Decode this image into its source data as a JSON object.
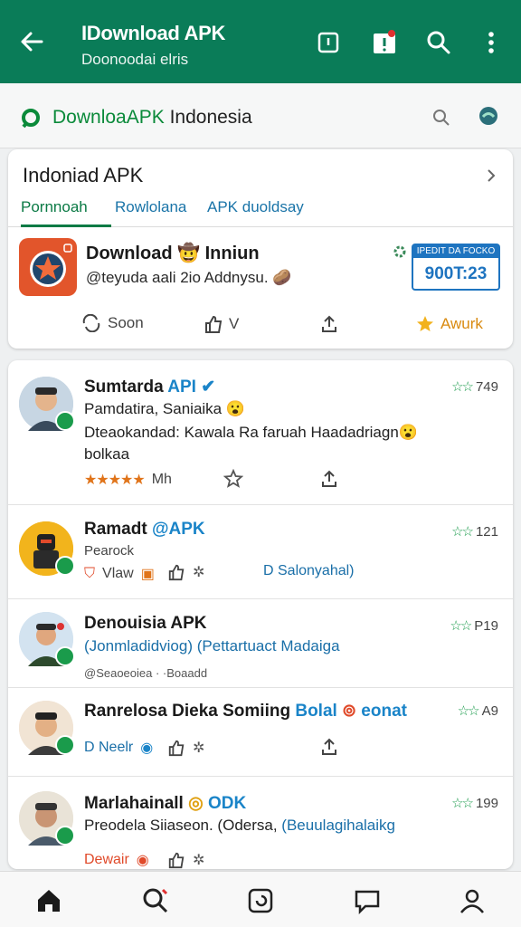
{
  "appbar": {
    "title": "IDownload APK",
    "subtitle": "Doonoodai elris",
    "icons": [
      "back-arrow-icon",
      "phone-icon",
      "alert-icon",
      "search-icon",
      "more-vert-icon"
    ]
  },
  "search": {
    "text_green": "DownloaAPK",
    "text_rest": " Indonesia"
  },
  "featured_card": {
    "title": "Indoniad APK",
    "tabs": [
      "Pornnoah",
      "Rowlolana",
      "APK duoldsay"
    ],
    "app_name": "Download",
    "app_name_suffix": "Inniun",
    "app_sub": "@teyuda aali 2io Addnysu.",
    "badge_top": "IPEDIT DA FOCKO",
    "badge_value": "900T:23",
    "actions": {
      "share": "Soon",
      "like": "V",
      "award": "Awurk"
    },
    "colors": {
      "award": "#e09a12",
      "accent": "#0a7c58"
    }
  },
  "feed": [
    {
      "name": "Sumtarda",
      "name_accent": "API",
      "line1": "Pamdatira, Saniaika",
      "line2": "Dteaokandad: Kawala Ra faruah Haadadriagn",
      "line3": "bolkaa",
      "rating": "749",
      "meta": "Mh"
    },
    {
      "name": "Ramadt",
      "name_accent": "APK",
      "line1": "Pearock",
      "rating": "121",
      "meta": "Vlaw",
      "link": "D Salonyahal)"
    },
    {
      "name": "Denouisia APK",
      "line1": "(Jonmladidviog)",
      "line1_link": "(Pettartuact Madaiga",
      "line2": "@Seaoeoiea · ·Boaadd",
      "rating": "P19"
    },
    {
      "name": "Ranrelosa Dieka Somiing",
      "name_accent": "Bolal",
      "name_extra": "eonat",
      "meta": "D Neelr",
      "rating": "A9"
    },
    {
      "name": "Marlahainall",
      "name_accent": "ODK",
      "line1": "Preodela Siiaseon. (Odersa,",
      "line1_link": "(Beuulagihalaikg",
      "meta": "Dewair",
      "rating": "199"
    }
  ],
  "bottom_nav": [
    "home-icon",
    "search-icon",
    "apps-icon",
    "chat-icon",
    "profile-icon"
  ]
}
